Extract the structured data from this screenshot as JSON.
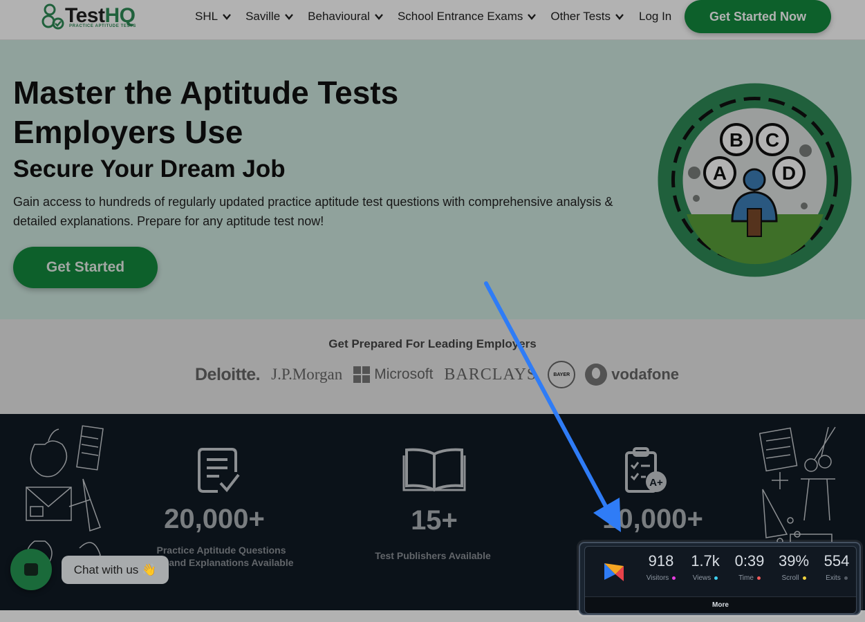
{
  "nav": {
    "logo_test": "Test",
    "logo_hq": "HQ",
    "logo_sub": "PRACTICE APTITUDE TESTS",
    "items": [
      {
        "label": "SHL"
      },
      {
        "label": "Saville"
      },
      {
        "label": "Behavioural"
      },
      {
        "label": "School Entrance Exams"
      },
      {
        "label": "Other Tests"
      }
    ],
    "login": "Log In",
    "cta": "Get Started Now"
  },
  "hero": {
    "title_line1": "Master the Aptitude Tests",
    "title_line2": "Employers Use",
    "subtitle": "Secure Your Dream Job",
    "body": "Gain access to hundreds of regularly updated practice aptitude test questions with comprehensive analysis & detailed explanations. Prepare for any aptitude test now!",
    "cta": "Get Started",
    "badge_letters": [
      "B",
      "C",
      "A",
      "D"
    ]
  },
  "employers": {
    "title": "Get Prepared For Leading Employers",
    "logos": [
      "Deloitte.",
      "J.P.Morgan",
      "Microsoft",
      "BARCLAYS",
      "BAYER",
      "vodafone"
    ]
  },
  "stats": [
    {
      "value": "20,000+",
      "label_line1": "Practice Aptitude Questions",
      "label_line2": "ons and Explanations Available",
      "icon": "document-check-icon"
    },
    {
      "value": "15+",
      "label_line1": "Test Publishers Available",
      "label_line2": "",
      "icon": "open-book-icon"
    },
    {
      "value": "10,000+",
      "label_line1": "",
      "label_line2": "",
      "icon": "clipboard-grade-icon"
    }
  ],
  "chat": {
    "label": "Chat with us",
    "emoji": "👋"
  },
  "widget": {
    "metrics": [
      {
        "value": "918",
        "label": "Visitors",
        "color": "#e83ee0"
      },
      {
        "value": "1.7k",
        "label": "Views",
        "color": "#3ed0f0"
      },
      {
        "value": "0:39",
        "label": "Time",
        "color": "#f05a5a"
      },
      {
        "value": "39%",
        "label": "Scroll",
        "color": "#f0d23e"
      },
      {
        "value": "554",
        "label": "Exits",
        "color": "#555c66"
      }
    ],
    "more": "More"
  },
  "colors": {
    "brand_green": "#138a3e",
    "hero_bg": "#cfe8e0",
    "stats_bg": "#111a24",
    "annotation_arrow": "#2f7cf6"
  }
}
